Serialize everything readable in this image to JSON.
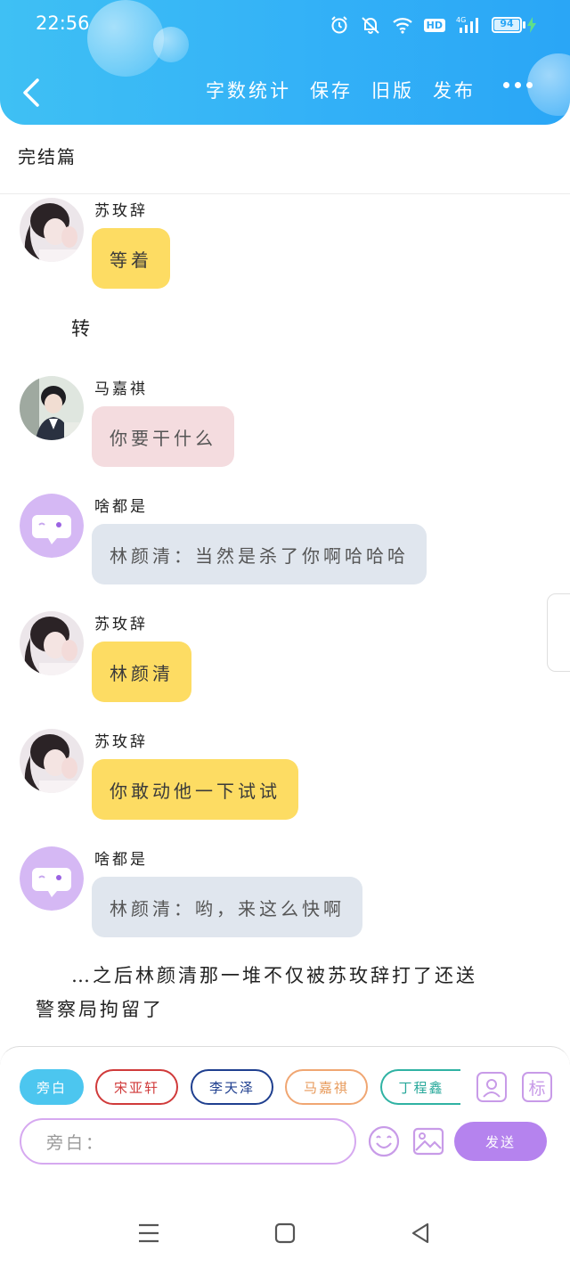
{
  "status_bar": {
    "time": "22:56",
    "network": "4G",
    "hd": "HD",
    "battery": "94",
    "battery_level": 0.94
  },
  "header": {
    "toolbar": [
      "字数统计",
      "保存",
      "旧版",
      "发布"
    ],
    "accent_color": "#33b1f7"
  },
  "chapter_title": "完结篇",
  "messages": [
    {
      "speaker": "苏玫辞",
      "text": "等着",
      "style": "yellow"
    },
    {
      "speaker": "马嘉祺",
      "text": "你要干什么",
      "style": "pink"
    },
    {
      "speaker": "啥都是",
      "text": "林颜清：当然是杀了你啊哈哈哈",
      "style": "gray"
    },
    {
      "speaker": "苏玫辞",
      "text": "林颜清",
      "style": "yellow"
    },
    {
      "speaker": "苏玫辞",
      "text": "你敢动他一下试试",
      "style": "yellow"
    },
    {
      "speaker": "啥都是",
      "text": "林颜清：哟，来这么快啊",
      "style": "gray"
    }
  ],
  "narration_turn": "转",
  "narration_end": {
    "line1": "…之后林颜清那一堆不仅被苏玫辞打了还送",
    "line2": "警察局拘留了"
  },
  "chips": [
    {
      "label": "旁白",
      "color": "#ffffff",
      "bg": "#4cc6ef",
      "border": "#4cc6ef"
    },
    {
      "label": "宋亚轩",
      "color": "#d03a3a",
      "bg": "#ffffff",
      "border": "#d03a3a"
    },
    {
      "label": "李天泽",
      "color": "#1f3f8f",
      "bg": "#ffffff",
      "border": "#1f3f8f"
    },
    {
      "label": "马嘉祺",
      "color": "#e79a5b",
      "bg": "#ffffff",
      "border": "#f0a672"
    },
    {
      "label": "丁程鑫",
      "color": "#27a89a",
      "bg": "#ffffff",
      "border": "#2fb2a3"
    }
  ],
  "tag_button": "标",
  "input": {
    "placeholder": "旁白："
  },
  "send_label": "发送"
}
